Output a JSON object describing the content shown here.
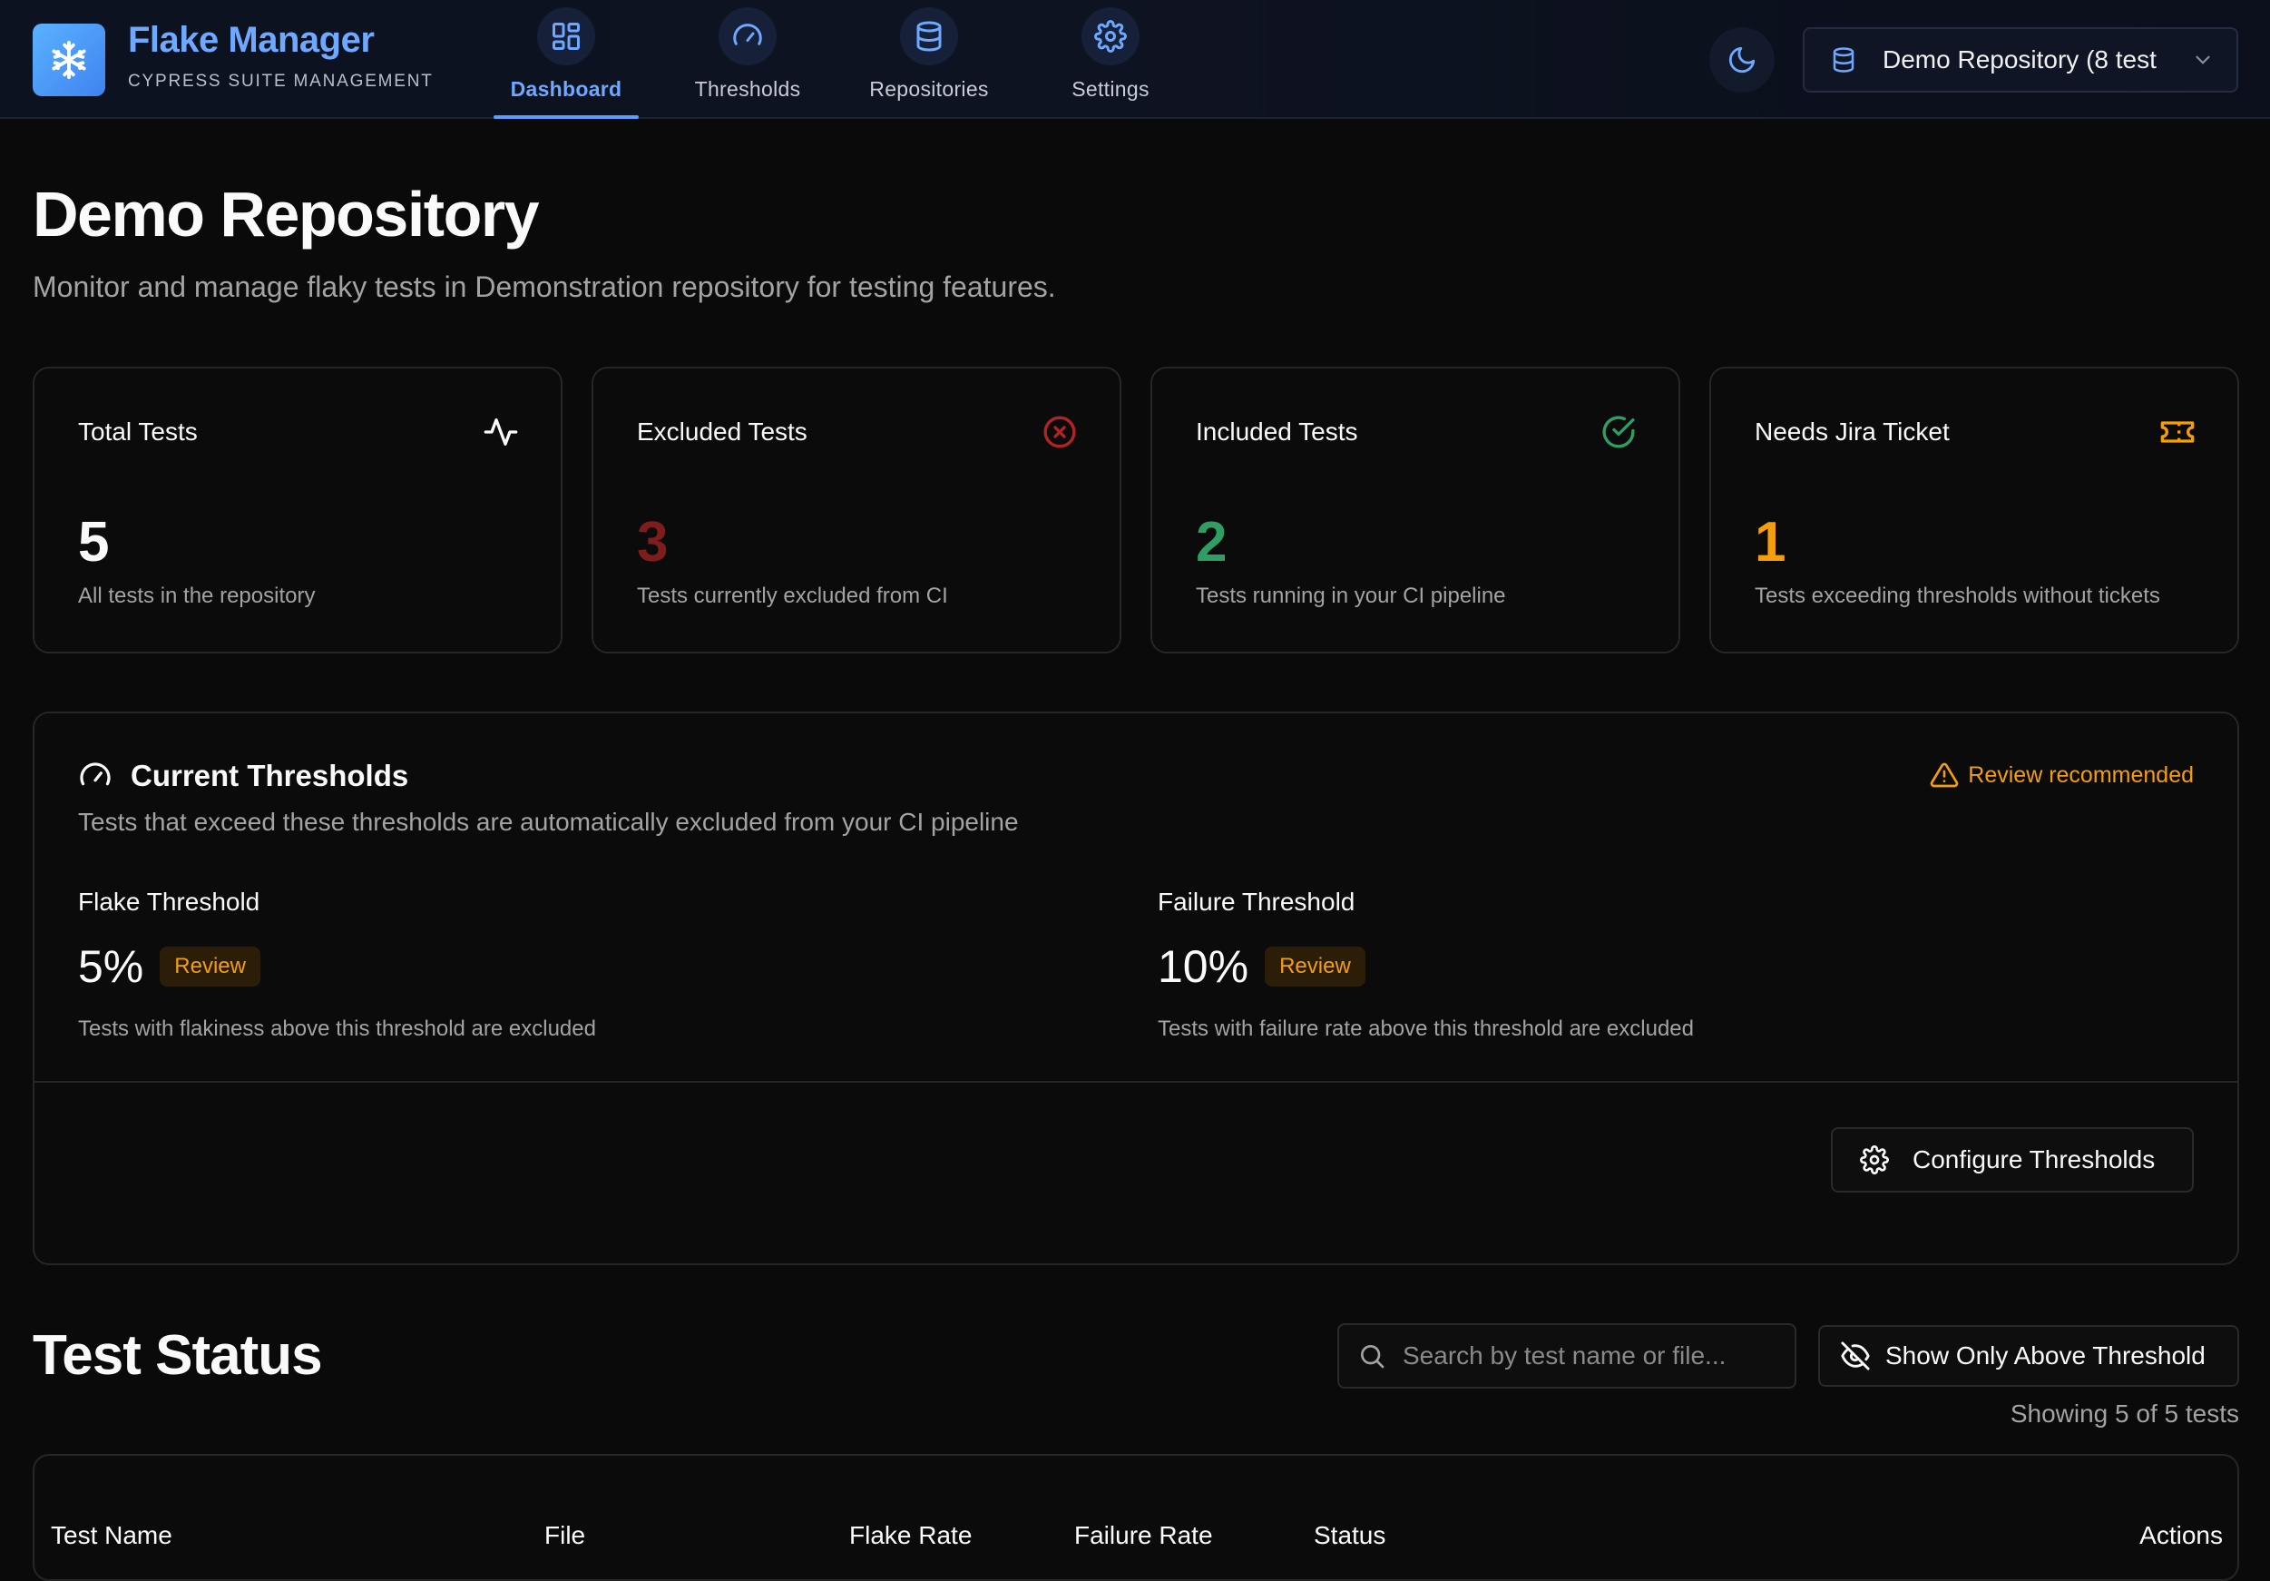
{
  "brand": {
    "title": "Flake Manager",
    "subtitle": "CYPRESS SUITE MANAGEMENT"
  },
  "nav": {
    "items": [
      {
        "label": "Dashboard",
        "icon": "dashboard-grid-icon",
        "active": true
      },
      {
        "label": "Thresholds",
        "icon": "gauge-icon",
        "active": false
      },
      {
        "label": "Repositories",
        "icon": "database-icon",
        "active": false
      },
      {
        "label": "Settings",
        "icon": "gear-icon",
        "active": false
      }
    ]
  },
  "repo_selector": {
    "value": "Demo Repository (8 test"
  },
  "page": {
    "title": "Demo Repository",
    "description": "Monitor and manage flaky tests in Demonstration repository for testing features."
  },
  "stats": [
    {
      "title": "Total Tests",
      "value": "5",
      "description": "All tests in the repository",
      "icon": "activity-icon",
      "color": "#fafafa"
    },
    {
      "title": "Excluded Tests",
      "value": "3",
      "description": "Tests currently excluded from CI",
      "icon": "x-circle-icon",
      "color": "#7f1d1d"
    },
    {
      "title": "Included Tests",
      "value": "2",
      "description": "Tests running in your CI pipeline",
      "icon": "check-circle-icon",
      "color": "#2f9e63"
    },
    {
      "title": "Needs Jira Ticket",
      "value": "1",
      "description": "Tests exceeding thresholds without tickets",
      "icon": "ticket-icon",
      "color": "#f59e0b"
    }
  ],
  "thresholds": {
    "title": "Current Thresholds",
    "review_notice": "Review recommended",
    "description": "Tests that exceed these thresholds are automatically excluded from your CI pipeline",
    "flake": {
      "label": "Flake Threshold",
      "value": "5%",
      "badge": "Review",
      "description": "Tests with flakiness above this threshold are excluded"
    },
    "failure": {
      "label": "Failure Threshold",
      "value": "10%",
      "badge": "Review",
      "description": "Tests with failure rate above this threshold are excluded"
    },
    "configure_label": "Configure Thresholds"
  },
  "test_status": {
    "title": "Test Status",
    "search_placeholder": "Search by test name or file...",
    "filter_label": "Show Only Above Threshold",
    "showing": "Showing 5 of 5 tests",
    "columns": [
      "Test Name",
      "File",
      "Flake Rate",
      "Failure Rate",
      "Status",
      "Actions"
    ]
  },
  "colors": {
    "accent": "#6ea8ff",
    "warning": "#f59e0b",
    "success": "#2f9e63",
    "danger": "#7f1d1d"
  }
}
